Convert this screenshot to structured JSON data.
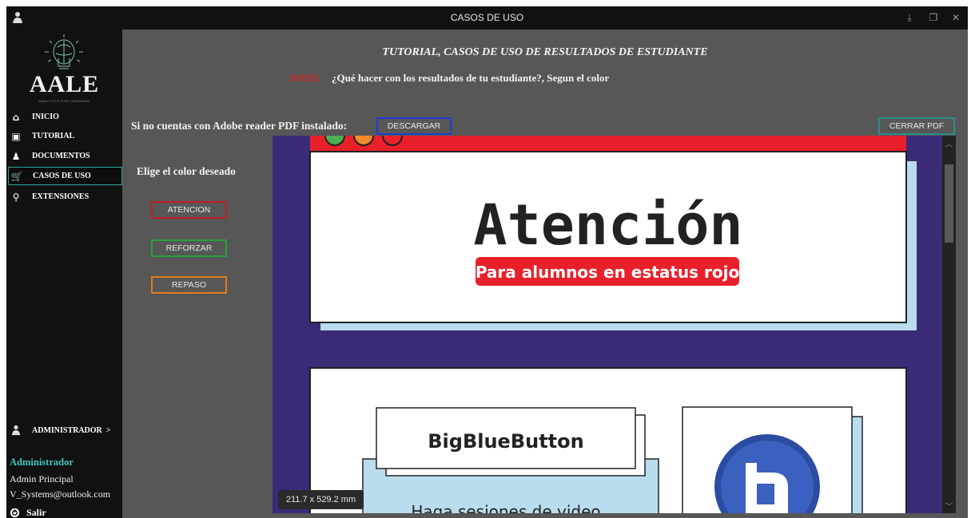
{
  "window": {
    "title": "CASOS DE USO"
  },
  "sidebar": {
    "logo_text": "AALE",
    "logo_subtext": "ANALYTICS FOR LEARNING",
    "items": [
      {
        "label": "INICIO",
        "icon": "home-icon"
      },
      {
        "label": "TUTORIAL",
        "icon": "tutorial-icon"
      },
      {
        "label": "DOCUMENTOS",
        "icon": "documents-icon"
      },
      {
        "label": "CASOS DE USO",
        "icon": "cart-icon",
        "active": true
      },
      {
        "label": "EXTENSIONES",
        "icon": "search-icon"
      }
    ],
    "admin_label": "ADMINISTRADOR  >",
    "user_role": "Administrador",
    "user_name": "Admin Principal",
    "user_email": "V_Systems@outlook.com",
    "logout_label": "Salir"
  },
  "main": {
    "heading": "TUTORIAL, CASOS DE USO DE RESULTADOS DE ESTUDIANTE",
    "note_label": "NOTA:",
    "note_text": "¿Qué hacer con los resultados de tu estudiante?, Segun el color",
    "download_prompt": "Si no cuentas con Adobe reader PDF instalado:",
    "download_button": "DESCARGAR",
    "close_pdf_button": "CERRAR PDF",
    "choose_color": "Elige el color deseado",
    "color_buttons": [
      "ATENCION",
      "REFORZAR",
      "REPASO"
    ]
  },
  "pdf": {
    "page1_title": "Atención",
    "page1_subtitle": "Para alumnos en estatus rojo",
    "page2_card_title": "BigBlueButton",
    "page2_card_text": "Haga sesiones de video",
    "page_size": "211.7 x 529.2 mm"
  },
  "colors": {
    "accent_teal": "#2aa198",
    "atencion": "#c02020",
    "reforzar": "#2aa23a",
    "repaso": "#e07a1a",
    "descargar": "#1a3fd0",
    "pdf_background": "#3b2a75",
    "pdf_red": "#e8202a"
  }
}
